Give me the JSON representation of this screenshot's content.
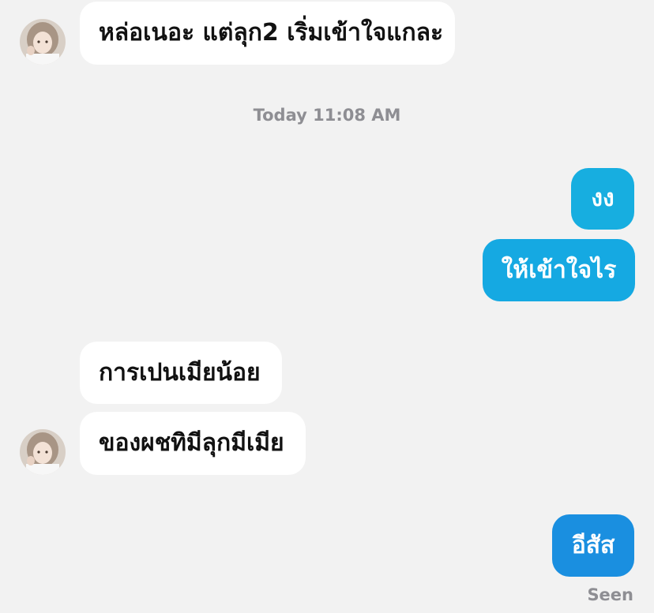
{
  "colors": {
    "background": "#f2f2f2",
    "incoming_bubble": "#ffffff",
    "outgoing_bubble_light": "#17aee0",
    "outgoing_bubble_dark": "#1a8fe0",
    "meta_text": "#8e8e93"
  },
  "messages": [
    {
      "direction": "incoming",
      "text": "หล่อเนอะ แต่ลุก2 เริ่มเข้าใจแกละ",
      "avatar": true
    },
    {
      "direction": "outgoing",
      "text": "งง"
    },
    {
      "direction": "outgoing",
      "text": "ให้เข้าใจไร"
    },
    {
      "direction": "incoming",
      "text": "การเปนเมียน้อย",
      "avatar": false
    },
    {
      "direction": "incoming",
      "text": "ของผชทิมีลุกมีเมีย",
      "avatar": true
    },
    {
      "direction": "outgoing",
      "text": "อีสัส"
    }
  ],
  "timestamp": "Today 11:08 AM",
  "status": "Seen"
}
